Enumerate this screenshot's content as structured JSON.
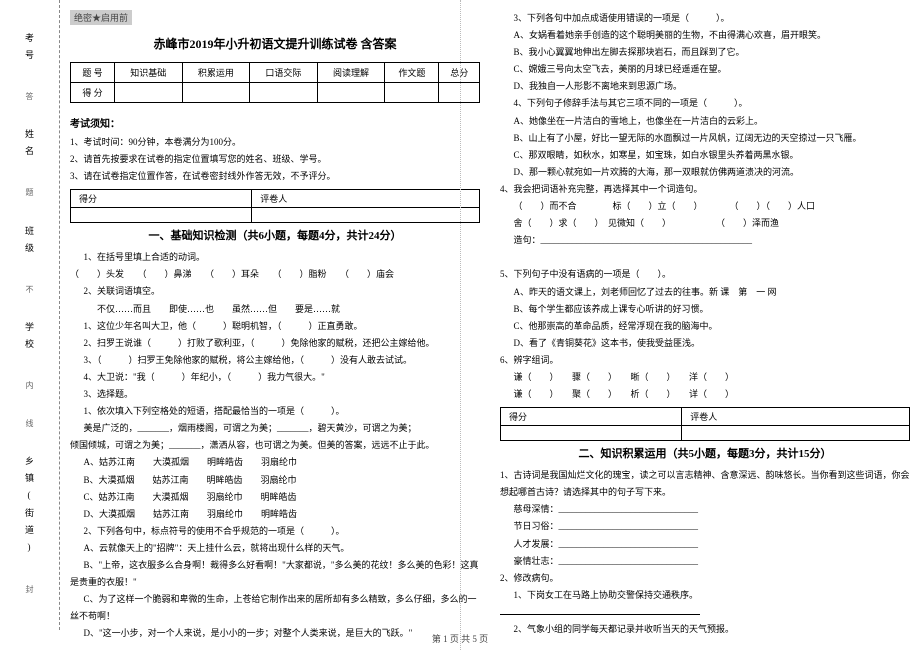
{
  "seal": "绝密★启用前",
  "title": "赤峰市2019年小升初语文提升训练试卷 含答案",
  "score_table": {
    "headers": [
      "题 号",
      "知识基础",
      "积累运用",
      "口语交际",
      "阅读理解",
      "作文题",
      "总分"
    ],
    "row_label": "得 分"
  },
  "notice_header": "考试须知：",
  "notices": [
    "1、考试时间：90分钟，本卷满分为100分。",
    "2、请首先按要求在试卷的指定位置填写您的姓名、班级、学号。",
    "3、请在试卷指定位置作答，在试卷密封线外作答无效，不予评分。"
  ],
  "scorebox": {
    "c1": "得分",
    "c2": "评卷人"
  },
  "section1_title": "一、基础知识检测（共6小题，每题4分，共计24分）",
  "q1_lead": "1、在括号里填上合适的动词。",
  "q1_line": "（　　）头发　　（　　）鼻涕　　（　　）耳朵　　（　　）脂粉　　（　　）庙会",
  "q2_lead": "2、关联词语填空。",
  "q2_hint": "不仅……而且　　即使……也　　虽然……但　　要是……就",
  "q2_items": [
    "1、这位少年名叫大卫，他（　　　）聪明机智，（　　　）正直勇敢。",
    "2、扫罗王说谁（　　　）打败了歌利亚，（　　　）免除他家的赋税，还把公主嫁给他。",
    "3、（　　　）扫罗王免除他家的赋税，将公主嫁给他，（　　　）没有人敢去试试。",
    "4、大卫说：\"我（　　　）年纪小，（　　　）我力气很大。\""
  ],
  "q3_lead": "3、选择题。",
  "q3_stem": "1、依次填入下列空格处的短语，搭配最恰当的一项是（　　　）。",
  "q3_p1": "美是广泛的，_______，烟雨楼阁，可谓之为美；_______，碧天黄沙，可谓之为美；",
  "q3_p2": "倾国倾城，可谓之为美；_______，潇洒从容，也可谓之为美。但美的答案，远远不止于此。",
  "q3_opts": [
    "A、姑苏江南　　大漠孤烟　　明眸皓齿　　羽扇纶巾",
    "B、大漠孤烟　　姑苏江南　　明眸皓齿　　羽扇纶巾",
    "C、姑苏江南　　大漠孤烟　　羽扇纶巾　　明眸皓齿",
    "D、大漠孤烟　　姑苏江南　　羽扇纶巾　　明眸皓齿"
  ],
  "q3b_stem": "2、下列各句中，标点符号的使用不合乎规范的一项是（　　　）。",
  "q3b_opts": [
    "A、云就像天上的\"招牌\"：天上挂什么云，就将出现什么样的天气。",
    "B、\"上帝，这衣服多么合身啊！裁得多么好看啊！\"大家都说，\"多么美的花纹！多么美的色彩！这真是贵重的衣服！\"",
    "C、为了这样一个脆弱和卑微的生命，上苍给它制作出来的居所却有多么精致，多么仔细，多么的一丝不苟啊！",
    "D、\"这一小步，对一个人来说，是小小的一步；对整个人类来说，是巨大的飞跃。\""
  ],
  "r_q3_lead": "3、下列各句中加点成语使用错误的一项是（　　　）。",
  "r_q3_opts": [
    "A、女娲看着她亲手创造的这个聪明美丽的生物，不由得满心欢喜，眉开眼笑。",
    "B、我小心翼翼地伸出左脚去探那块岩石，而且踩到了它。",
    "C、嫦娥三号向太空飞去，美丽的月球已经遥遥在望。",
    "D、我独自一人形影不离地来到思源广场。"
  ],
  "r_q4_lead": "4、下列句子修辞手法与其它三项不同的一项是（　　　）。",
  "r_q4_opts": [
    "A、她像坐在一片洁白的雪地上，也像坐在一片洁白的云彩上。",
    "B、山上有了小屋，好比一望无际的水面飘过一片风帆，辽阔无边的天空掠过一只飞雁。",
    "C、那双眼睛，如秋水，如寒星，如宝珠，如白水银里头养着两黑水银。",
    "D、那一颗心就宛如一片欢腾的大海，那一双眼就仿佛两道溃决的河流。"
  ],
  "r_q5_lead": "4、我会把词语补充完整，再选择其中一个词造句。",
  "r_q5_l1": "（　　）而不合　　　　标（　　）立（　　）　　　　（　　）（　　）人口",
  "r_q5_l2": "舍（　　）求（　　）　见微知（　　）　　　　　　（　　）泽而渔",
  "r_q5_make": "造句：_______________________________________________",
  "r_q6_lead": "5、下列句子中没有语病的一项是（　　）。",
  "r_q6_opts": [
    "A、昨天的语文课上，刘老师回忆了过去的往事。新 课　第　一 网",
    "B、每个学生都应该养成上课专心听讲的好习惯。",
    "C、他那崇高的革命品质，经常浮现在我的脑海中。",
    "D、看了《青铜葵花》这本书，使我受益匪浅。"
  ],
  "r_q7_lead": "6、辨字组词。",
  "r_q7_l1": "谦（　　）　　骤（　　）　　晰（　　）　　洋（　　）",
  "r_q7_l2": "谦（　　）　　聚（　　）　　析（　　）　　详（　　）",
  "section2_title": "二、知识积累运用（共5小题，每题3分，共计15分）",
  "s2_q1_lead": "1、古诗词是我国灿烂文化的瑰宝，读之可以言志精神、含意深远、韵味悠长。当你看到这些词语，你会想起哪首古诗？请选择其中的句子写下来。",
  "s2_lines": [
    "慈母深情：_______________________________",
    "节日习俗：_______________________________",
    "人才发展：_______________________________",
    "豪情壮志：_______________________________"
  ],
  "s2_q2_lead": "2、修改病句。",
  "s2_q2_items": [
    "1、下岗女工在马路上协助交警保持交通秩序。",
    "2、气象小组的同学每天都记录并收听当天的天气预报。"
  ],
  "gutter": {
    "labels": [
      "考号",
      "姓名",
      "班级",
      "学校",
      "乡镇(街道)"
    ],
    "hints": [
      "答",
      "题",
      "不",
      "内",
      "线",
      "封"
    ]
  },
  "footer": "第 1 页 共 5 页"
}
